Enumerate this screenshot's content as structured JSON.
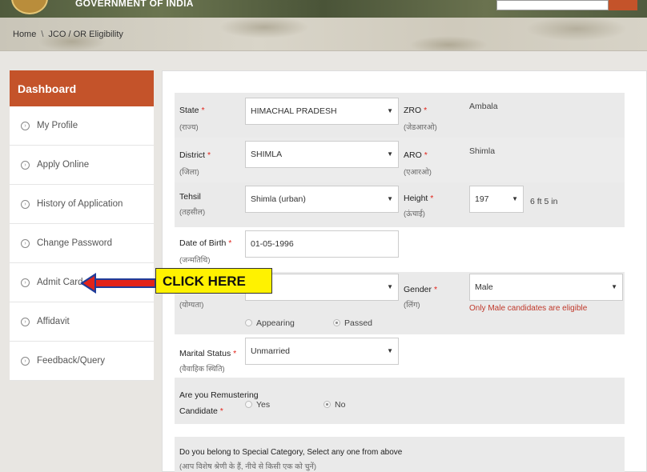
{
  "header": {
    "title": "GOVERNMENT OF INDIA"
  },
  "breadcrumb": {
    "home": "Home",
    "separator": "\\",
    "current": "JCO / OR Eligibility"
  },
  "sidebar": {
    "heading": "Dashboard",
    "items": [
      {
        "label": "My Profile",
        "icon": "chevron-circle-right-icon"
      },
      {
        "label": "Apply Online",
        "icon": "chevron-circle-right-icon"
      },
      {
        "label": "History of Application",
        "icon": "chevron-circle-right-icon"
      },
      {
        "label": "Change Password",
        "icon": "chevron-circle-right-icon"
      },
      {
        "label": "Admit Card",
        "icon": "chevron-circle-right-icon"
      },
      {
        "label": "Affidavit",
        "icon": "chevron-circle-right-icon"
      },
      {
        "label": "Feedback/Query",
        "icon": "chevron-circle-right-icon"
      }
    ]
  },
  "annotation": {
    "label": "CLICK HERE",
    "arrow_color": "#e2231a"
  },
  "form": {
    "state": {
      "label": "State",
      "sub": "(राज्य)",
      "value": "HIMACHAL PRADESH"
    },
    "zro": {
      "label": "ZRO",
      "sub": "(जेडआरओ)",
      "value": "Ambala"
    },
    "district": {
      "label": "District",
      "sub": "(जिला)",
      "value": "SHIMLA"
    },
    "aro": {
      "label": "ARO",
      "sub": "(एआरओ)",
      "value": "Shimla"
    },
    "tehsil": {
      "label": "Tehsil",
      "sub": "(तहसील)",
      "value": "Shimla (urban)"
    },
    "height": {
      "label": "Height",
      "sub": "(ऊंचाई)",
      "value": "197",
      "converted": "6 ft 5 in"
    },
    "dob": {
      "label": "Date of Birth",
      "sub": "(जन्मतिथि)",
      "value": "01-05-1996"
    },
    "qualification": {
      "sub": "(योग्यता)",
      "value": "",
      "radio_appearing": "Appearing",
      "radio_passed": "Passed"
    },
    "gender": {
      "label": "Gender",
      "sub": "(लिंग)",
      "value": "Male",
      "note": "Only Male candidates are eligible"
    },
    "marital": {
      "label": "Marital Status",
      "sub": "(वैवाहिक स्थिति)",
      "value": "Unmarried"
    },
    "remustering": {
      "label_line1": "Are you Remustering",
      "label_line2": "Candidate",
      "yes": "Yes",
      "no": "No"
    },
    "special": {
      "label": "Do you belong to Special Category, Select any one from above",
      "sub": "(आप विशेष श्रेणी के हैं, नीचे से किसी एक को चुनें)"
    }
  },
  "colors": {
    "accent": "#c4532a",
    "required": "#e2231a",
    "highlight": "#fff200"
  }
}
